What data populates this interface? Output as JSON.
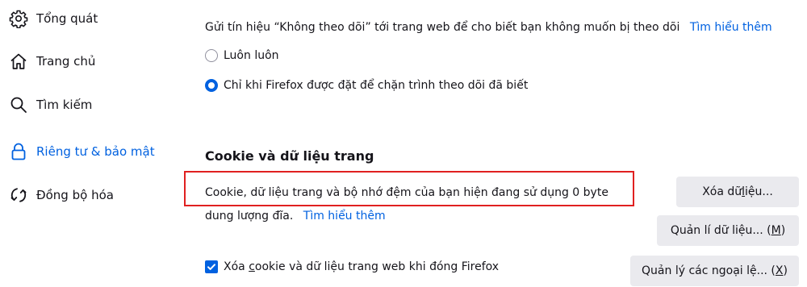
{
  "sidebar": {
    "items": [
      {
        "label": "Tổng quát",
        "icon": "gear-icon"
      },
      {
        "label": "Trang chủ",
        "icon": "home-icon"
      },
      {
        "label": "Tìm kiếm",
        "icon": "search-icon"
      },
      {
        "label": "Riêng tư & bảo mật",
        "icon": "lock-icon",
        "selected": true
      },
      {
        "label": "Đồng bộ hóa",
        "icon": "sync-icon"
      }
    ]
  },
  "dnt": {
    "description": "Gửi tín hiệu “Không theo dõi” tới trang web để cho biết bạn không muốn bị theo dõi",
    "learn_more": "Tìm hiểu thêm",
    "options": [
      {
        "label": "Luôn luôn",
        "checked": false
      },
      {
        "label": "Chỉ khi Firefox được đặt để chặn trình theo dõi đã biết",
        "checked": true
      }
    ]
  },
  "cookies": {
    "heading": "Cookie và dữ liệu trang",
    "usage_line1": "Cookie, dữ liệu trang và bộ nhớ đệm của bạn hiện đang sử dụng 0 byte",
    "usage_line2": "dung lượng đĩa.",
    "learn_more": "Tìm hiểu thêm",
    "delete_on_close": {
      "label_prefix": "Xóa ",
      "label_underlined": "c",
      "label_rest": "ookie và dữ liệu trang web khi đóng Firefox",
      "checked": true
    },
    "buttons": {
      "clear": {
        "prefix": "Xóa dữ ",
        "underlined": "l",
        "suffix": "iệu..."
      },
      "manage": {
        "prefix": "Quản lí dữ liệu... (",
        "underlined": "M",
        "suffix": ")"
      },
      "exceptions": {
        "prefix": "Quản lý các ngoại lệ... (",
        "underlined": "X",
        "suffix": ")"
      }
    }
  },
  "colors": {
    "accent": "#0061e0",
    "highlight": "#e02020"
  }
}
